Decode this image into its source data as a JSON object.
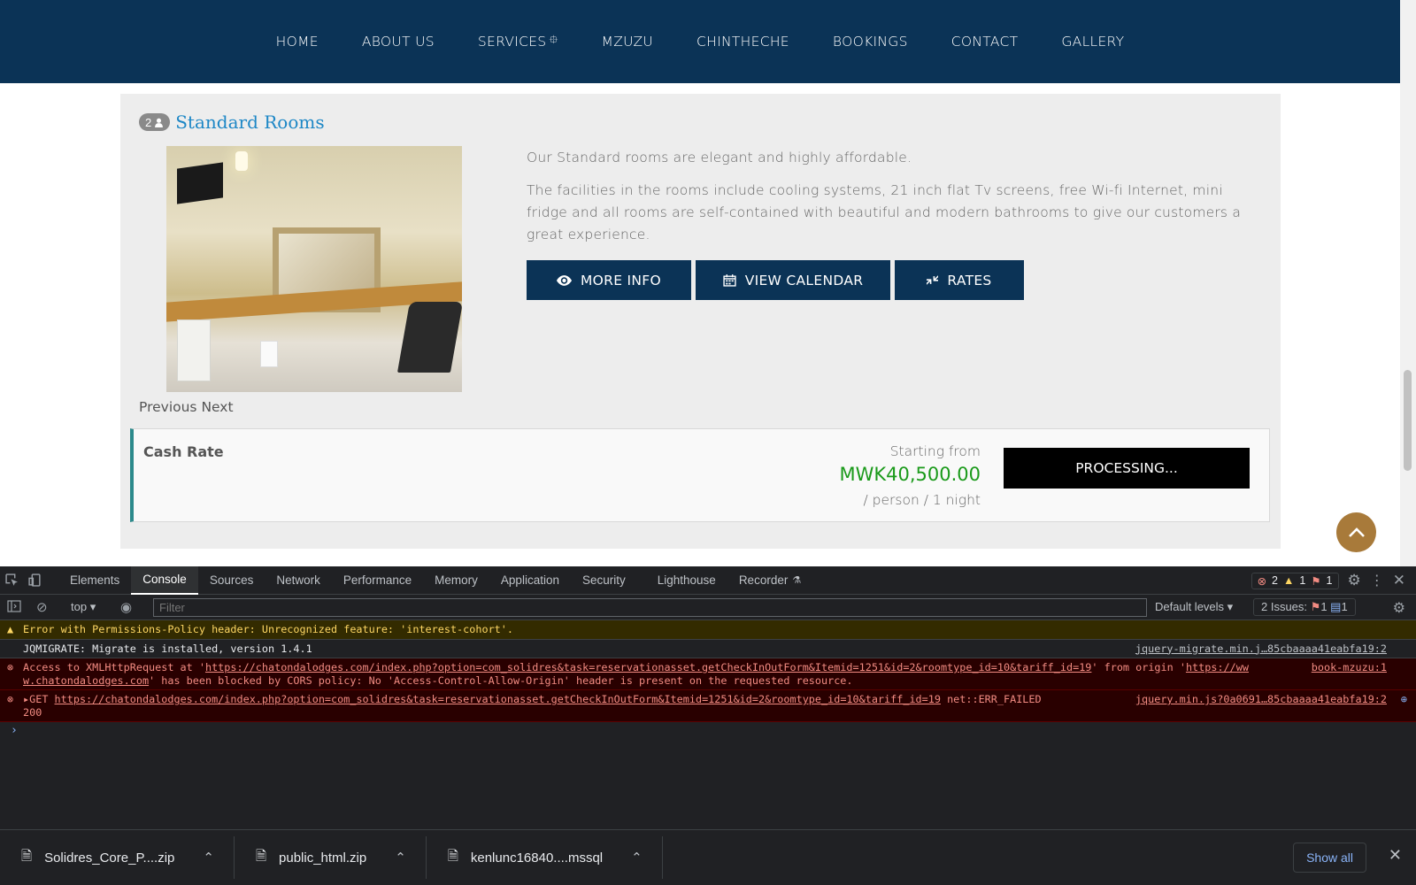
{
  "nav": {
    "items": [
      {
        "label": "HOME"
      },
      {
        "label": "ABOUT US"
      },
      {
        "label": "SERVICES"
      },
      {
        "label": "MZUZU"
      },
      {
        "label": "CHINTHECHE"
      },
      {
        "label": "BOOKINGS"
      },
      {
        "label": "CONTACT"
      },
      {
        "label": "GALLERY"
      }
    ],
    "caret": "⯐"
  },
  "room": {
    "occupancy": "2",
    "title": "Standard Rooms",
    "description": [
      "Our Standard rooms are elegant and highly affordable.",
      "The facilities in the rooms include cooling systems, 21 inch flat Tv screens, free Wi-fi Internet, mini fridge and all rooms are self-contained with beautiful and modern bathrooms to give our customers a great experience."
    ],
    "buttons": {
      "more_info": "MORE INFO",
      "calendar": "VIEW CALENDAR",
      "rates": "RATES"
    },
    "carousel": {
      "prev": "Previous",
      "next": "Next"
    },
    "tariff": {
      "name": "Cash Rate",
      "from_label": "Starting from",
      "price": "MWK40,500.00",
      "unit": "/ person / 1 night",
      "action": "PROCESSING..."
    }
  },
  "devtools": {
    "tabs": [
      "Elements",
      "Console",
      "Sources",
      "Network",
      "Performance",
      "Memory",
      "Application",
      "Security",
      "Lighthouse",
      "Recorder"
    ],
    "active_tab": "Console",
    "errors_count": "2",
    "warnings_count": "1",
    "issues_badge": "1",
    "context": "top",
    "filter_placeholder": "Filter",
    "levels": "Default levels",
    "issues_label": "2 Issues:",
    "issues_red": "1",
    "issues_blue": "1",
    "messages": {
      "warn": "Error with Permissions-Policy header: Unrecognized feature: 'interest-cohort'.",
      "info": "JQMIGRATE: Migrate is installed, version 1.4.1",
      "info_src": "jquery-migrate.min.j…85cbaaaa41eabfa19:2",
      "cors_prefix": "Access to XMLHttpRequest at '",
      "cors_url": "https://chatondalodges.com/index.php?option=com_solidres&task=reservationasset.getCheckInOutForm&Itemid=1251&id=2&roomtype_id=10&tariff_id=19",
      "cors_mid": "' from origin '",
      "cors_origin_a": "https://ww",
      "cors_origin_b": "w.chatondalodges.com",
      "cors_suffix": "' has been blocked by CORS policy: No 'Access-Control-Allow-Origin' header is present on the requested resource.",
      "cors_src": "book-mzuzu:1",
      "get_prefix": "GET ",
      "get_url": "https://chatondalodges.com/index.php?option=com_solidres&task=reservationasset.getCheckInOutForm&Itemid=1251&id=2&roomtype_id=10&tariff_id=19",
      "get_suffix": " net::ERR_FAILED",
      "get_status": "200",
      "get_src": "jquery.min.js?0a0691…85cbaaaa41eabfa19:2"
    }
  },
  "downloads": {
    "items": [
      {
        "name": "Solidres_Core_P....zip"
      },
      {
        "name": "public_html.zip"
      },
      {
        "name": "kenlunc16840....mssql"
      }
    ],
    "show_all": "Show all"
  }
}
